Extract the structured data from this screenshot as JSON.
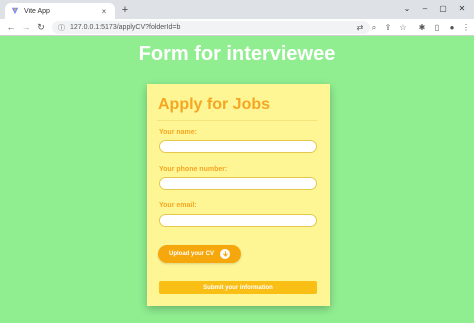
{
  "browser": {
    "tab_title": "Vite App",
    "tab_close": "×",
    "new_tab": "+",
    "url": "127.0.0.1:5173/applyCV?folderId=b",
    "window_controls": [
      "⌄",
      "–",
      "▢",
      "✕"
    ],
    "icons": {
      "back": "back-arrow-icon",
      "forward": "forward-arrow-icon",
      "reload": "reload-icon",
      "site_info": "info-icon",
      "translate": "translate-icon",
      "zoom": "zoom-icon",
      "share": "share-icon",
      "bookmark": "star-icon",
      "extensions": "puzzle-icon",
      "sidepanel": "sidepanel-icon",
      "profile": "profile-icon",
      "menu": "kebab-menu-icon"
    }
  },
  "page": {
    "heading": "Form for interviewee"
  },
  "form": {
    "title": "Apply for Jobs",
    "name_label": "Your name:",
    "name_value": "",
    "phone_label": "Your phone number:",
    "phone_value": "",
    "email_label": "Your email:",
    "email_value": "",
    "upload_label": "Upload your CV",
    "submit_label": "Submit your information"
  },
  "colors": {
    "page_bg": "#90ee90",
    "card_bg": "#fef695",
    "accent": "#f5a623",
    "upload_bg": "#f5a70c",
    "submit_bg": "#f9bf14"
  }
}
